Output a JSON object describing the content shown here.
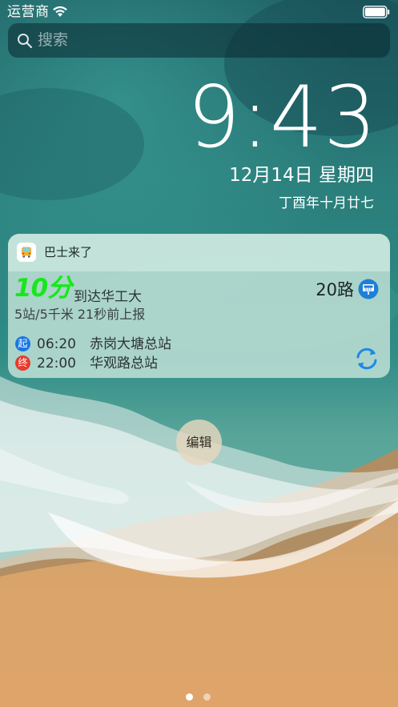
{
  "status_bar": {
    "carrier": "运营商"
  },
  "search": {
    "placeholder": "搜索"
  },
  "lock": {
    "time": "9:43",
    "date": "12月14日 星期四",
    "lunar_date": "丁酉年十月廿七"
  },
  "widget": {
    "app_name": "巴士来了",
    "eta": "10分",
    "destination_label": "到达华工大",
    "meta": "5站/5千米 21秒前上报",
    "route": "20路",
    "stops": [
      {
        "badge": "起",
        "time": "06:20",
        "name": "赤岗大塘总站"
      },
      {
        "badge": "终",
        "time": "22:00",
        "name": "华观路总站"
      }
    ]
  },
  "edit_label": "编辑",
  "colors": {
    "eta": "#17e81b",
    "start_badge": "#1976e0",
    "end_badge": "#e63b2e",
    "refresh": "#1e88e5"
  },
  "icons": [
    "wifi-icon",
    "battery-icon",
    "search-icon",
    "bus-app-icon",
    "bus-stop-icon",
    "refresh-icon"
  ],
  "pages": {
    "count": 2,
    "current": 1
  }
}
